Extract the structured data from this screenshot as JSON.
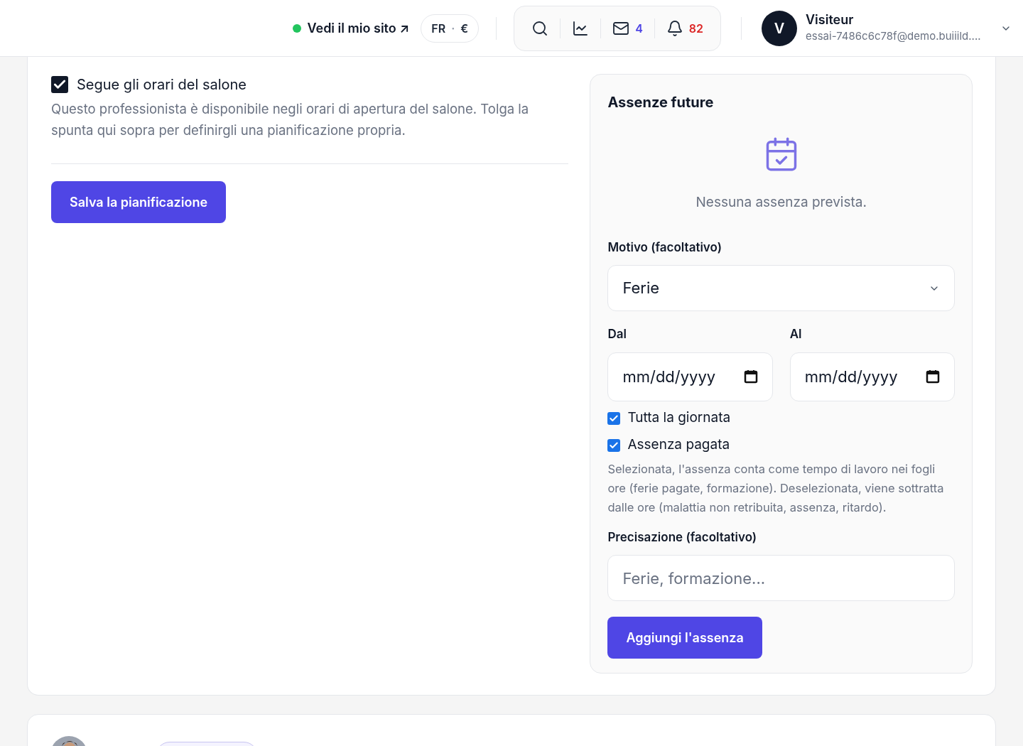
{
  "header": {
    "site_link": {
      "label": "Vedi il mio sito ↗",
      "online": true
    },
    "locale": {
      "language": "FR",
      "separator": "·",
      "currency": "€"
    },
    "toolbar": [
      {
        "kind": "search"
      },
      {
        "kind": "stats"
      },
      {
        "kind": "mail",
        "count": "4",
        "color": "#4f46e5"
      },
      {
        "kind": "bell",
        "count": "82",
        "color": "#dc2626"
      }
    ],
    "user": {
      "initial": "V",
      "name": "Visiteur",
      "email": "essai-7486c6c78f@demo.buiiild...."
    }
  },
  "schedule": {
    "follow_salon_hours": {
      "label": "Segue gli orari del salone",
      "checked": true
    },
    "help": "Questo professionista è disponibile negli orari di apertura del salone. Tolga la spunta qui sopra per definirgli una pianificazione propria.",
    "save_button": "Salva la pianificazione"
  },
  "absences": {
    "title": "Assenze future",
    "empty_text": "Nessuna assenza prevista.",
    "reason": {
      "label": "Motivo (facoltativo)",
      "value": "Ferie"
    },
    "from": {
      "label": "Dal",
      "placeholder": "mm/dd/yyyy"
    },
    "to": {
      "label": "Al",
      "placeholder": "mm/dd/yyyy"
    },
    "options": [
      {
        "label": "Tutta la giornata",
        "checked": true
      },
      {
        "label": "Assenza pagata",
        "checked": true
      }
    ],
    "paid_help": "Selezionata, l'assenza conta come tempo di lavoro nei fogli ore (ferie pagate, formazione). Deselezionata, viene sottratta dalle ore (malattia non retribuita, assenza, ritardo).",
    "note": {
      "label": "Precisazione (facoltativo)",
      "placeholder": "Ferie, formazione..."
    },
    "add_button": "Aggiungi l'assenza"
  }
}
